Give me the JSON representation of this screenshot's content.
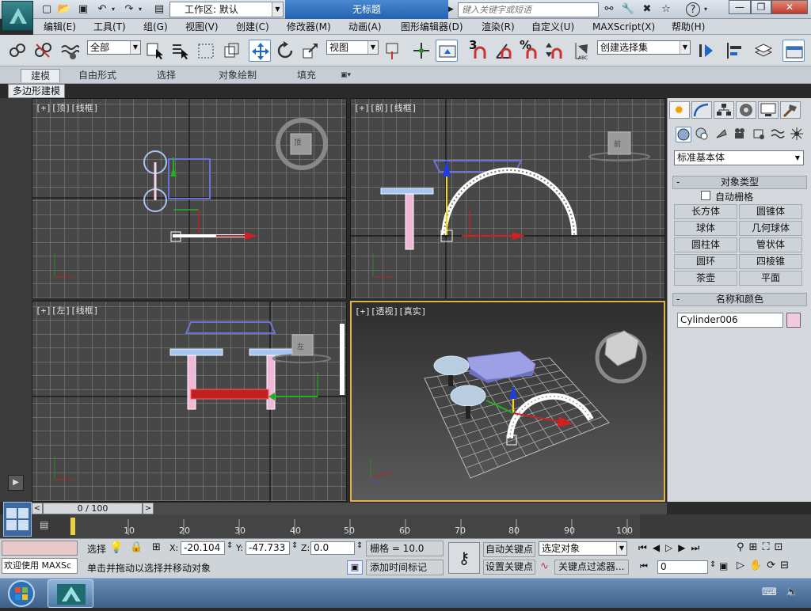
{
  "titlebar": {
    "workspace": "工作区: 默认",
    "title": "无标题",
    "search_placeholder": "键入关键字或短语",
    "minimize": "—",
    "maximize": "❐",
    "close": "✕"
  },
  "menu": [
    "编辑(E)",
    "工具(T)",
    "组(G)",
    "视图(V)",
    "创建(C)",
    "修改器(M)",
    "动画(A)",
    "图形编辑器(D)",
    "渲染(R)",
    "自定义(U)",
    "MAXScript(X)",
    "帮助(H)"
  ],
  "toolbar": {
    "filter_select": "全部",
    "coord_select": "视图",
    "snap_3": "3",
    "snap_percent": "%",
    "named_selection": "创建选择集"
  },
  "ribbon": {
    "tabs": [
      "建模",
      "自由形式",
      "选择",
      "对象绘制",
      "填充"
    ],
    "sub_label": "多边形建模"
  },
  "viewports": {
    "top": "[+][顶][线框]",
    "front": "[+][前][线框]",
    "left": "[+][左][线框]",
    "persp": "[+][透视][真实]",
    "cube_top": "顶",
    "cube_front": "前",
    "cube_left": "左"
  },
  "command_panel": {
    "category": "标准基本体",
    "object_type_title": "对象类型",
    "auto_grid": "自动栅格",
    "buttons": [
      "长方体",
      "圆锥体",
      "球体",
      "几何球体",
      "圆柱体",
      "管状体",
      "圆环",
      "四棱锥",
      "茶壶",
      "平面"
    ],
    "name_color_title": "名称和颜色",
    "object_name": "Cylinder006",
    "object_color": "#f4c8e0"
  },
  "timeline": {
    "frame": "0 / 100",
    "ticks": [
      "10",
      "20",
      "30",
      "40",
      "50",
      "60",
      "70",
      "80",
      "90",
      "100"
    ]
  },
  "status": {
    "welcome": "欢迎使用 MAXSc",
    "select_label": "选择",
    "x_label": "X:",
    "x_value": "-20.104",
    "y_label": "Y:",
    "y_value": "-47.733",
    "z_label": "Z:",
    "z_value": "0.0",
    "grid": "栅格 = 10.0",
    "prompt": "单击并拖动以选择并移动对象",
    "add_time_tag": "添加时间标记",
    "auto_key": "自动关键点",
    "set_key": "设置关键点",
    "key_select": "选定对象",
    "key_filter": "关键点过滤器...",
    "frame_field": "0"
  },
  "colors": {
    "active_viewport_border": "#e3b34a",
    "selection_pink": "#f4c8e0"
  }
}
